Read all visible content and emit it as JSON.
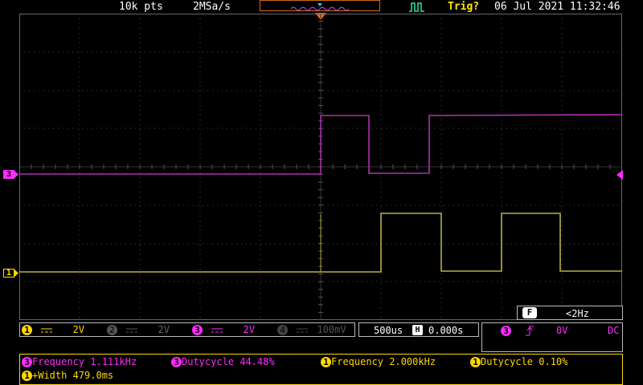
{
  "top": {
    "points": "10k pts",
    "sample_rate": "2MSa/s",
    "trigger_status": "Trig?",
    "datetime": "06 Jul 2021 11:32:46"
  },
  "channels": [
    {
      "num": "1",
      "scale": "2V",
      "color": "#ffd700"
    },
    {
      "num": "2",
      "scale": "2V",
      "color": "#666666"
    },
    {
      "num": "3",
      "scale": "2V",
      "color": "#ff2bff"
    },
    {
      "num": "4",
      "scale": "100mV",
      "color": "#555555"
    }
  ],
  "timebase": {
    "scale": "500us",
    "delay_icon": "H",
    "offset": "0.000s"
  },
  "filter": {
    "label": "F",
    "value": "<2Hz"
  },
  "trigger": {
    "source": "3",
    "edge": "rising-edge-icon",
    "level": "0V",
    "coupling": "DC"
  },
  "measurements": [
    {
      "source": "3",
      "text": "Frequency 1.111kHz"
    },
    {
      "source": "3",
      "text": "Dutycycle 44.48%"
    },
    {
      "source": "1",
      "text": "Frequency 2.000kHz"
    },
    {
      "source": "1",
      "text": "Dutycycle 0.10%"
    },
    {
      "source": "1",
      "text": "+Width 479.0ms"
    }
  ],
  "ground_markers": [
    {
      "label": "3"
    },
    {
      "label": "1"
    }
  ],
  "colors": {
    "ch1": "#b8b04a",
    "ch3": "#b030b0",
    "grid": "#4a4a4a",
    "trigger_marker": "#ff6a00",
    "accent_border": "#d2691e"
  }
}
